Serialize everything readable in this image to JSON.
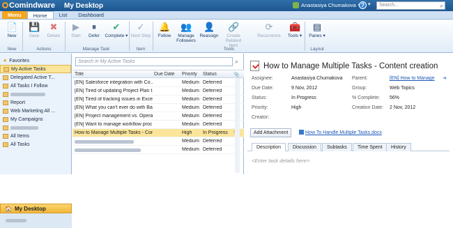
{
  "titlebar": {
    "logo_text": "Comindware",
    "app_title": "My Desktop",
    "user_name": "Anastasiya Chumakova",
    "help_label": "?",
    "help_dd": "▾",
    "search_placeholder": "Search..."
  },
  "tabs": [
    {
      "label": "Menu"
    },
    {
      "label": "Home"
    },
    {
      "label": "List"
    },
    {
      "label": "Dashboard"
    }
  ],
  "ribbon": {
    "buttons": {
      "new": "New",
      "save": "Save",
      "delete": "Delete",
      "start": "Start",
      "defer": "Defer",
      "complete": "Complete",
      "next_step": "Next Step",
      "follow": "Follow",
      "manage_followers": "Manage Followers",
      "reassign": "Reassign",
      "create_related": "Create Related Item",
      "recurrence": "Recurrence",
      "tools": "Tools",
      "panes": "Panes"
    },
    "groups": {
      "new": "New",
      "actions": "Actions",
      "manage_task": "Manage Task",
      "item": "Item",
      "tools": "Tools",
      "layout": "Layout"
    }
  },
  "leftnav": {
    "favorites": "Favorites",
    "items": [
      {
        "label": "My Active Tasks"
      },
      {
        "label": "Delegated Active T..."
      },
      {
        "label": "All Tasks I Follow"
      },
      {
        "label": "Report"
      },
      {
        "label": "Web Marketing All ..."
      },
      {
        "label": "My Campaigns"
      },
      {
        "label": "All Items"
      },
      {
        "label": "All Tasks"
      }
    ],
    "my_desktop": "My Desktop"
  },
  "tasklist": {
    "search_placeholder": "Search in My Active Tasks",
    "columns": {
      "title": "Title",
      "due": "Due Date",
      "priority": "Priority",
      "status": "Status"
    },
    "rows": [
      {
        "title": "[EN] Salesforce integration with Co...",
        "due": "",
        "priority": "Medium",
        "status": "Deferred"
      },
      {
        "title": "[EN] Tired of updating Project Plan t...",
        "due": "",
        "priority": "Medium",
        "status": "Deferred"
      },
      {
        "title": "[EN] Tired of tracking issues in Excel...",
        "due": "",
        "priority": "Medium",
        "status": "Deferred"
      },
      {
        "title": "[EN] What you can't ever do with Ba...",
        "due": "",
        "priority": "Medium",
        "status": "Deferred"
      },
      {
        "title": "[EN] Project management vs. Opera...",
        "due": "",
        "priority": "Medium",
        "status": "Deferred"
      },
      {
        "title": "[EN] Want to manage workflow proc...",
        "due": "",
        "priority": "Medium",
        "status": "Deferred"
      },
      {
        "title": "How to Manage Multiple Tasks - Con...",
        "due": "",
        "priority": "High",
        "status": "In Progress"
      },
      {
        "title": "",
        "due": "",
        "priority": "Medium",
        "status": "Deferred"
      },
      {
        "title": "",
        "due": "",
        "priority": "Medium",
        "status": "Deferred"
      }
    ]
  },
  "detail": {
    "title": "How to Manage Multiple Tasks - Content creation",
    "assignee_label": "Assignee:",
    "assignee": "Anastasiya Chumakova",
    "due_label": "Due Date:",
    "due": "9 Nov, 2012",
    "status_label": "Status:",
    "status": "In Progress",
    "priority_label": "Priority:",
    "priority": "High",
    "creator_label": "Creator:",
    "parent_label": "Parent:",
    "parent": "[EN] How to Manage",
    "group_label": "Group:",
    "group": "Web Topics",
    "complete_label": "% Complete:",
    "complete": "56%",
    "creation_label": "Creation Date:",
    "creation": "2 Nov, 2012",
    "add_attachment": "Add Attachment",
    "attachment": "How To Handle Multiple Tasks.docx",
    "tabs": [
      "Description",
      "Discussion",
      "Subtasks",
      "Time Spent",
      "History"
    ],
    "details_placeholder": "<Enter task details here>"
  }
}
